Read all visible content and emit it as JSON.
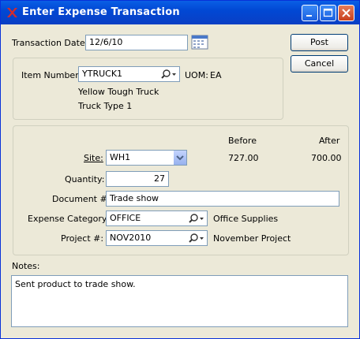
{
  "window": {
    "title": "Enter Expense Transaction"
  },
  "header": {
    "transaction_date_label": "Transaction Date:",
    "transaction_date_value": "12/6/10"
  },
  "buttons": {
    "post_label": "Post",
    "cancel_label": "Cancel"
  },
  "item": {
    "item_number_label": "Item Number:",
    "item_number_value": "YTRUCK1",
    "uom_label": "UOM:",
    "uom_value": "EA",
    "description1": "Yellow Tough Truck",
    "description2": "Truck Type 1"
  },
  "transaction": {
    "before_label": "Before",
    "after_label": "After",
    "site_label": "Site:",
    "site_value": "WH1",
    "before_value": "727.00",
    "after_value": "700.00",
    "quantity_label": "Quantity:",
    "quantity_value": "27",
    "document_label": "Document #:",
    "document_value": "Trade show",
    "expense_category_label": "Expense Category:",
    "expense_category_value": "OFFICE",
    "expense_category_desc": "Office Supplies",
    "project_label": "Project #:",
    "project_value": "NOV2010",
    "project_desc": "November Project"
  },
  "notes": {
    "label": "Notes:",
    "text": "Sent product to trade show."
  },
  "icons": {
    "app": "xtuple-x-icon",
    "calendar": "calendar-icon",
    "lookup": "magnifier-dropdown-icon",
    "combo": "chevron-down-icon"
  }
}
